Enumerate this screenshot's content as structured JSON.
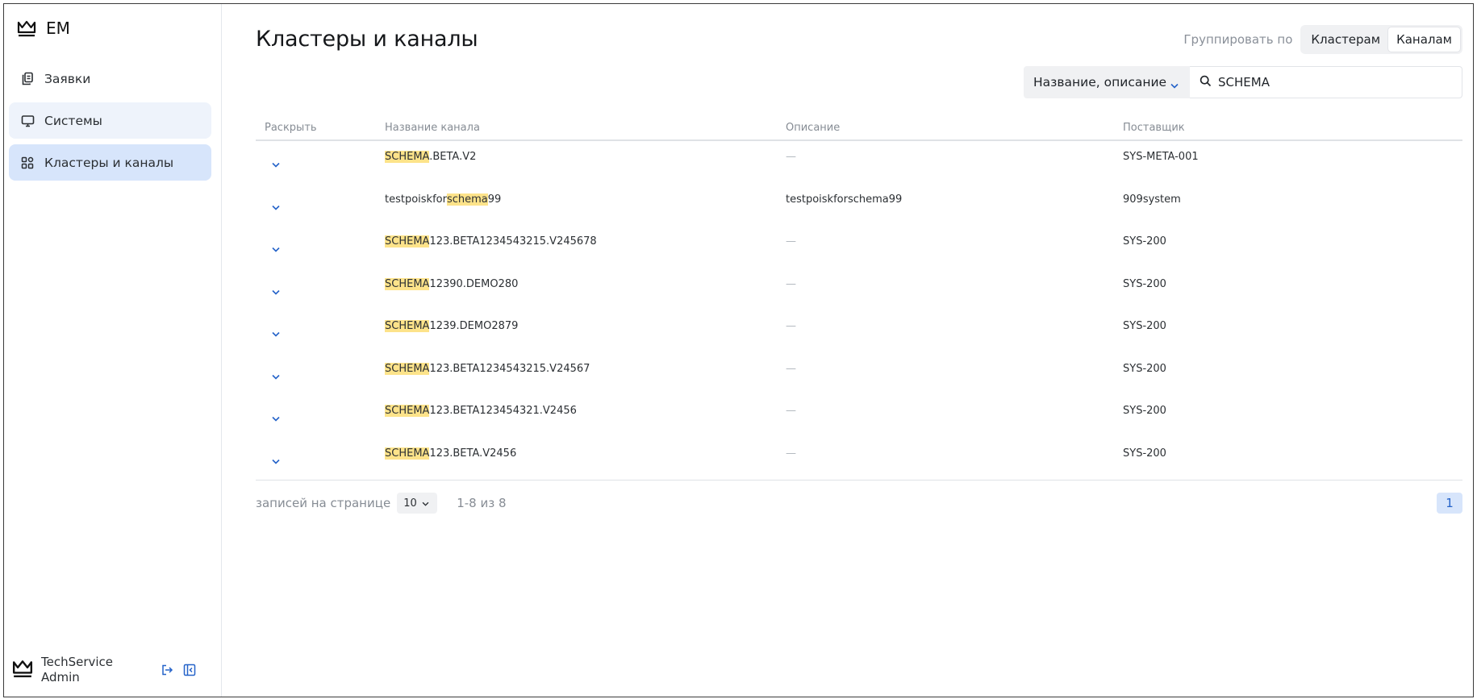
{
  "app": {
    "title": "EM"
  },
  "sidebar": {
    "items": [
      {
        "label": "Заявки",
        "icon": "documents-icon"
      },
      {
        "label": "Системы",
        "icon": "monitor-icon"
      },
      {
        "label": "Кластеры и каналы",
        "icon": "grid-icon",
        "active": true
      }
    ]
  },
  "user": {
    "line1": "TechService",
    "line2": "Admin"
  },
  "page": {
    "title": "Кластеры и каналы"
  },
  "group_by": {
    "label": "Группировать по",
    "options": [
      "Кластерам",
      "Каналам"
    ],
    "selected": "Каналам"
  },
  "filter": {
    "field": "Название, описание",
    "query": "SCHEMA"
  },
  "table": {
    "headers": {
      "expand": "Раскрыть",
      "name": "Название канала",
      "description": "Описание",
      "provider": "Поставщик"
    },
    "rows": [
      {
        "name_prefix": "",
        "name_match": "SCHEMA",
        "name_suffix": ".BETA.V2",
        "description": "—",
        "provider": "SYS-META-001"
      },
      {
        "name_prefix": "testpoiskfor",
        "name_match": "schema",
        "name_suffix": "99",
        "description": "testpoiskforschema99",
        "provider": "909system"
      },
      {
        "name_prefix": "",
        "name_match": "SCHEMA",
        "name_suffix": "123.BETA1234543215.V245678",
        "description": "—",
        "provider": "SYS-200"
      },
      {
        "name_prefix": "",
        "name_match": "SCHEMA",
        "name_suffix": "12390.DEMO280",
        "description": "—",
        "provider": "SYS-200"
      },
      {
        "name_prefix": "",
        "name_match": "SCHEMA",
        "name_suffix": "1239.DEMO2879",
        "description": "—",
        "provider": "SYS-200"
      },
      {
        "name_prefix": "",
        "name_match": "SCHEMA",
        "name_suffix": "123.BETA1234543215.V24567",
        "description": "—",
        "provider": "SYS-200"
      },
      {
        "name_prefix": "",
        "name_match": "SCHEMA",
        "name_suffix": "123.BETA123454321.V2456",
        "description": "—",
        "provider": "SYS-200"
      },
      {
        "name_prefix": "",
        "name_match": "SCHEMA",
        "name_suffix": "123.BETA.V2456",
        "description": "—",
        "provider": "SYS-200"
      }
    ]
  },
  "pagination": {
    "per_page_label": "записей на странице",
    "per_page": "10",
    "range": "1-8 из 8",
    "current_page": "1"
  },
  "colors": {
    "accent": "#2563c9",
    "active_nav": "#d7e5fb",
    "highlight": "#fde38a"
  }
}
